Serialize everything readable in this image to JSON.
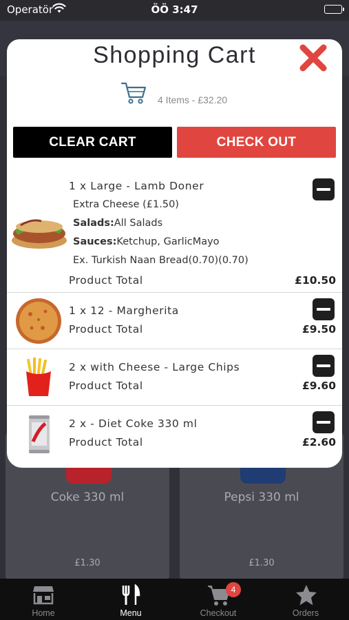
{
  "status_bar": {
    "carrier": "Operatör",
    "time": "ÖÖ 3:47"
  },
  "background": {
    "cards": [
      {
        "name": "Coke 330 ml",
        "price": "£1.30",
        "color": "#b8222a"
      },
      {
        "name": "Pepsi 330 ml",
        "price": "£1.30",
        "color": "#1f3c73"
      }
    ]
  },
  "cart": {
    "title": "Shopping Cart",
    "summary": "4 Items - £32.20",
    "clear_label": "CLEAR CART",
    "checkout_label": "CHECK OUT",
    "items": [
      {
        "title": "1 x Large - Lamb Doner",
        "image": "doner-kebab",
        "extra": "Extra Cheese (£1.50)",
        "salads_label": "Salads:",
        "salads_value": "All Salads",
        "sauces_label": "Sauces:",
        "sauces_value": "Ketchup, GarlicMayo",
        "bread": "Ex. Turkish Naan Bread(0.70)(0.70)",
        "total_label": "Product Total",
        "total": "£10.50"
      },
      {
        "title": "1 x 12 - Margherita",
        "image": "pizza",
        "total_label": "Product Total",
        "total": "£9.50"
      },
      {
        "title": "2 x with Cheese - Large Chips",
        "image": "fries",
        "total_label": "Product Total",
        "total": "£9.60"
      },
      {
        "title": "2 x - Diet Coke 330 ml",
        "image": "diet-coke-can",
        "total_label": "Product Total",
        "total": "£2.60"
      }
    ]
  },
  "tabs": [
    {
      "label": "Home",
      "icon": "store-icon",
      "active": false
    },
    {
      "label": "Menu",
      "icon": "cutlery-icon",
      "active": true
    },
    {
      "label": "Checkout",
      "icon": "cart-icon",
      "active": false,
      "badge": "4"
    },
    {
      "label": "Orders",
      "icon": "star-icon",
      "active": false
    }
  ],
  "colors": {
    "accent": "#e0463f",
    "dark": "#000000",
    "tab_bar": "#0f0f10"
  }
}
